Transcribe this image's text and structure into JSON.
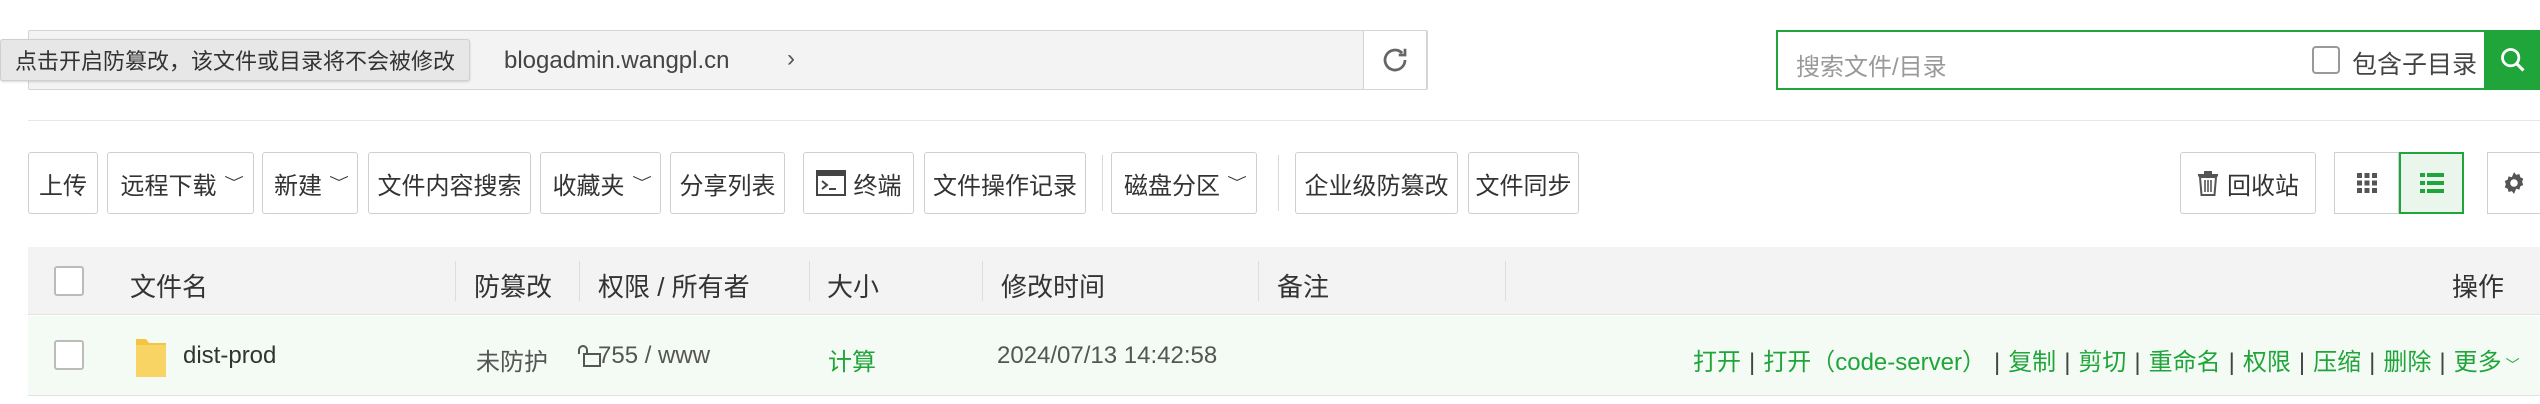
{
  "path_bar": {
    "crumb": "blogadmin.wangpl.cn",
    "tooltip": "点击开启防篡改，该文件或目录将不会被修改"
  },
  "search": {
    "placeholder": "搜索文件/目录",
    "include_sub_label": "包含子目录"
  },
  "toolbar": {
    "upload": "上传",
    "remote_download": "远程下载",
    "new": "新建",
    "content_search": "文件内容搜索",
    "favorites": "收藏夹",
    "share_list": "分享列表",
    "terminal": "终端",
    "op_log": "文件操作记录",
    "disk": "磁盘分区",
    "enterprise_tamper": "企业级防篡改",
    "file_sync": "文件同步",
    "recycle_bin": "回收站"
  },
  "table": {
    "headers": {
      "name": "文件名",
      "tamper": "防篡改",
      "perm": "权限 / 所有者",
      "size": "大小",
      "mtime": "修改时间",
      "note": "备注",
      "ops": "操作"
    },
    "rows": [
      {
        "name": "dist-prod",
        "tamper": "未防护",
        "perm": "755 / www",
        "size": "计算",
        "mtime": "2024/07/13 14:42:58",
        "note": ""
      }
    ],
    "ops": [
      "打开",
      "打开（code-server）",
      "复制",
      "剪切",
      "重命名",
      "权限",
      "压缩",
      "删除",
      "更多"
    ]
  },
  "colors": {
    "accent": "#20a53a",
    "row_bg": "#f4fbf5"
  },
  "icons": [
    "refresh-icon",
    "search-icon",
    "terminal-icon",
    "trash-icon",
    "grid-view-icon",
    "list-view-icon",
    "gear-icon",
    "folder-icon",
    "lock-open-icon",
    "chevron-down-icon"
  ]
}
